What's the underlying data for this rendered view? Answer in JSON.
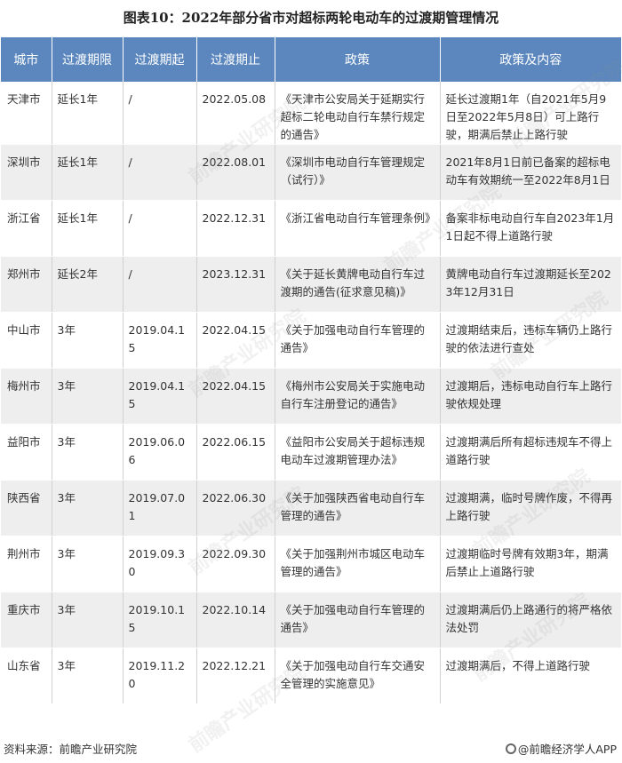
{
  "title": "图表10：2022年部分省市对超标两轮电动车的过渡期管理情况",
  "headers": [
    "城市",
    "过渡期限",
    "过渡期起",
    "过渡期止",
    "政策",
    "政策及内容"
  ],
  "rows": [
    [
      "天津市",
      "延长1年",
      "/",
      "2022.05.08",
      "《天津市公安局关于延期实行超标二轮电动自行车禁行规定的通告》",
      "延长过渡期1年（自2021年5月9日至2022年5月8日）可上路行驶，期满后禁止上路行驶"
    ],
    [
      "深圳市",
      "延长1年",
      "/",
      "2022.08.01",
      "《深圳市电动自行车管理规定（试行）》",
      "2021年8月1日前已备案的超标电动车有效期统一至2022年8月1日"
    ],
    [
      "浙江省",
      "延长1年",
      "/",
      "2022.12.31",
      "《浙江省电动自行车管理条例》",
      "备案非标电动自行车自2023年1月1日起不得上道路行驶"
    ],
    [
      "郑州市",
      "延长2年",
      "/",
      "2023.12.31",
      "《关于延长黄牌电动自行车过渡期的通告(征求意见稿)》",
      "黄牌电动自行车过渡期延长至2023年12月31日"
    ],
    [
      "中山市",
      "3年",
      "2019.04.15",
      "2022.04.15",
      "《关于加强电动自行车管理的通告》",
      "过渡期结束后，违标车辆仍上路行驶的依法进行查处"
    ],
    [
      "梅州市",
      "3年",
      "2019.04.15",
      "2022.04.15",
      "《梅州市公安局关于实施电动自行车注册登记的通告》",
      "过渡期后，违标电动自行车上路行驶依规处理"
    ],
    [
      "益阳市",
      "3年",
      "2019.06.06",
      "2022.06.15",
      "《益阳市公安局关于超标违规电动车过渡期管理办法》",
      "过渡期满后所有超标违规车不得上道路行驶"
    ],
    [
      "陕西省",
      "3年",
      "2019.07.01",
      "2022.06.30",
      "《关于加强陕西省电动自行车管理的通告》",
      "过渡期满，临时号牌作废，不得再上路行驶"
    ],
    [
      "荆州市",
      "3年",
      "2019.09.30",
      "2022.09.30",
      "《关于加强荆州市城区电动车管理的通告》",
      "过渡期临时号牌有效期3年，期满后禁止上道路行驶"
    ],
    [
      "重庆市",
      "3年",
      "2019.10.15",
      "2022.10.14",
      "《关于加强电动自行车管理的通告》",
      "过渡期满后仍上路通行的将严格依法处罚"
    ],
    [
      "山东省",
      "3年",
      "2019.11.20",
      "2022.12.21",
      "《关于加强电动自行车交通安全管理的实施意见》",
      "过渡期满后，不得上道路行驶"
    ]
  ],
  "watermark": "前瞻产业研究院",
  "footer": {
    "source": "资料来源：前瞻产业研究院",
    "app": "@前瞻经济学人APP"
  }
}
